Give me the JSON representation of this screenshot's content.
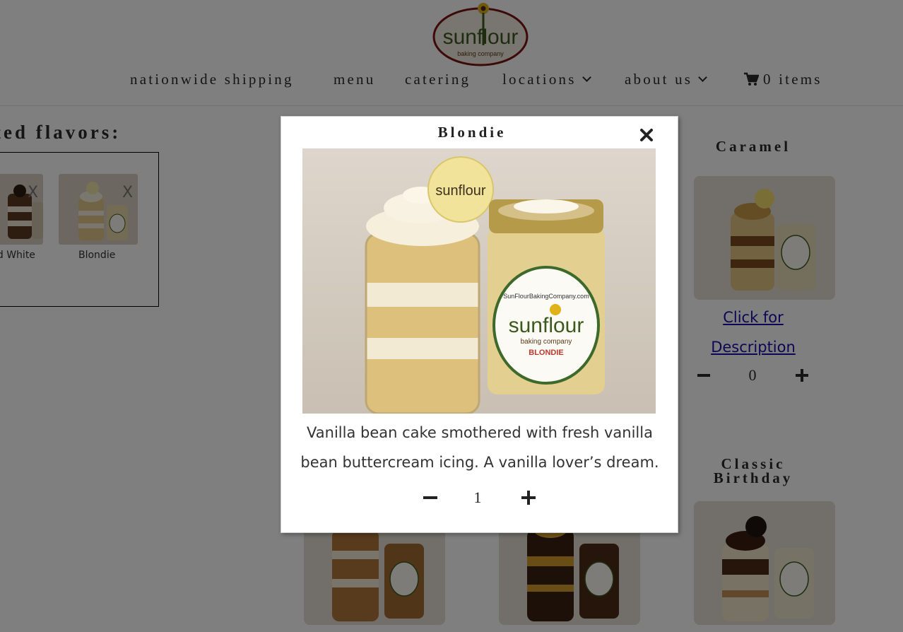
{
  "nav": {
    "items": [
      {
        "label": "nationwide shipping"
      },
      {
        "label": "menu"
      },
      {
        "label": "catering"
      },
      {
        "label": "locations"
      },
      {
        "label": "about us"
      }
    ],
    "cart_label": "0 items",
    "cart_icon": "shopping-cart-icon"
  },
  "logo": {
    "brand": "sunflour",
    "tagline": "baking company"
  },
  "selected": {
    "title": "ted flavors:",
    "items": [
      {
        "label": "nd White",
        "remove": "X"
      },
      {
        "label": "Blondie",
        "remove": "X"
      }
    ]
  },
  "products": {
    "caramel": {
      "title": "Caramel",
      "link_line1": "Click for",
      "link_line2": "Description",
      "qty": "0"
    },
    "classic": {
      "title_line1": "Classic",
      "title_line2": "Birthday"
    }
  },
  "modal": {
    "title": "Blondie",
    "description": "Vanilla bean cake smothered with fresh vanilla bean buttercream icing. A vanilla lover’s dream.",
    "qty": "1",
    "jar_brand": "sunflour",
    "jar_tagline": "baking company",
    "jar_flavor": "BLONDIE",
    "jar_url": "SunFlourBakingCompany.com"
  },
  "colors": {
    "accent": "#8a1c1c",
    "logo_green": "#3d5a1e",
    "link": "#1a0dab"
  }
}
